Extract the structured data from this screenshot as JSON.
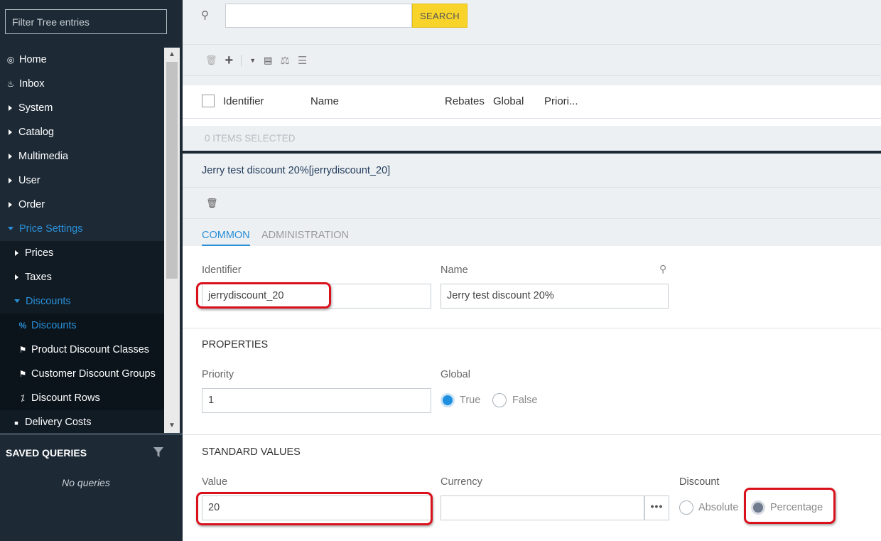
{
  "sidebar": {
    "filter_placeholder": "Filter Tree entries",
    "tree": [
      {
        "label": "Home",
        "icon": "palette-icon",
        "glyph": "◎"
      },
      {
        "label": "Inbox",
        "icon": "inbox-icon",
        "glyph": "♨"
      },
      {
        "label": "System"
      },
      {
        "label": "Catalog"
      },
      {
        "label": "Multimedia"
      },
      {
        "label": "User"
      },
      {
        "label": "Order"
      },
      {
        "label": "Price Settings"
      },
      {
        "label": "Prices"
      },
      {
        "label": "Taxes"
      },
      {
        "label": "Discounts"
      },
      {
        "label": "Discounts",
        "icon": "percent-icon",
        "glyph": "%"
      },
      {
        "label": "Product Discount Classes",
        "icon": "product-discount-icon",
        "glyph": "⚑"
      },
      {
        "label": "Customer Discount Groups",
        "icon": "customer-discount-icon",
        "glyph": "⚑"
      },
      {
        "label": "Discount Rows",
        "icon": "discount-rows-icon",
        "glyph": "⁒"
      },
      {
        "label": "Delivery Costs",
        "icon": "truck-icon",
        "glyph": "■"
      }
    ],
    "saved_queries_title": "SAVED QUERIES",
    "saved_queries_empty": "No queries"
  },
  "search": {
    "button_label": "SEARCH",
    "value": ""
  },
  "table": {
    "columns": [
      "Identifier",
      "Name",
      "Rebates",
      "Global",
      "Priori..."
    ],
    "selection_text": "0 ITEMS SELECTED"
  },
  "detail": {
    "title": "Jerry test discount 20%[jerrydiscount_20]",
    "tabs": [
      "COMMON",
      "ADMINISTRATION"
    ],
    "identifier_label": "Identifier",
    "identifier_value": "jerrydiscount_20",
    "name_label": "Name",
    "name_value": "Jerry test discount 20%",
    "properties_title": "PROPERTIES",
    "priority_label": "Priority",
    "priority_value": "1",
    "global_label": "Global",
    "global_true": "True",
    "global_false": "False",
    "standard_values_title": "STANDARD VALUES",
    "value_label": "Value",
    "value_value": "20",
    "currency_label": "Currency",
    "currency_value": "",
    "currency_button": "•••",
    "discount_label": "Discount",
    "discount_absolute": "Absolute",
    "discount_percentage": "Percentage"
  },
  "colors": {
    "sidebar_bg": "#1d2a36",
    "accent": "#2a8fd7",
    "search_button": "#f8d42b",
    "highlight": "#d9111c"
  }
}
